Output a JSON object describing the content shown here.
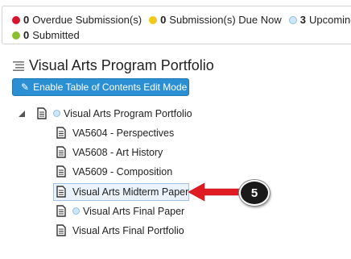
{
  "status_bar": {
    "overdue": {
      "count": "0",
      "label": "Overdue Submission(s)",
      "color": "#d9132c"
    },
    "due_now": {
      "count": "0",
      "label": "Submission(s) Due Now",
      "color": "#f2c81b"
    },
    "upcoming": {
      "count": "3",
      "label": "Upcoming",
      "color": "#cfe6f7"
    },
    "submitted": {
      "count": "0",
      "label": "Submitted",
      "color": "#8bbf2a"
    }
  },
  "page": {
    "title": "Visual Arts Program Portfolio",
    "edit_button_label": "Enable Table of Contents Edit Mode"
  },
  "tree": {
    "root": {
      "label": "Visual Arts Program Portfolio",
      "icon": "document-icon",
      "status": "upcoming"
    },
    "items": [
      {
        "label": "VA5604 - Perspectives"
      },
      {
        "label": "VA5608 - Art History"
      },
      {
        "label": "VA5609 - Composition"
      },
      {
        "label": "Visual Arts Midterm Paper",
        "selected": true
      },
      {
        "label": "Visual Arts Final Paper",
        "status": "upcoming"
      },
      {
        "label": "Visual Arts Final Portfolio"
      }
    ]
  },
  "callout": {
    "step": "5",
    "arrow_color": "#e01b22"
  }
}
